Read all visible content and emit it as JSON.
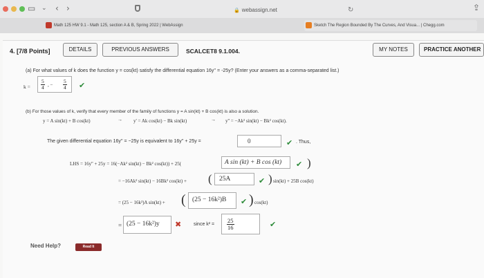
{
  "browser": {
    "url": "webassign.net",
    "tabs": [
      {
        "label": "Math 125 HW 9.1 - Math 125, section A & B, Spring 2022 | WebAssign",
        "color": "#c0392b"
      },
      {
        "label": "Sketch The Region Bounded By The Curves, And Visua... | Chegg.com",
        "color": "#e67e22"
      }
    ]
  },
  "question": {
    "number": "4.",
    "points": "[7/8 Points]",
    "buttons": {
      "details": "DETAILS",
      "previous_answers": "PREVIOUS ANSWERS",
      "my_notes": "MY NOTES",
      "practice": "PRACTICE ANOTHER"
    },
    "source": "SCALCET8 9.1.004.",
    "part_a": {
      "prompt": "(a) For what values of k does the function y = cos(kt) satisfy the differential equation 16y'' = -25y? (Enter your answers as a comma-separated list.)",
      "k_label": "k =",
      "answer_num1": "5",
      "answer_den1": "4",
      "answer_sep": ", −",
      "answer_num2": "5",
      "answer_den2": "4"
    },
    "part_b": {
      "prompt": "(b) For those values of k, verify that every member of the family of functions y = A sin(kt) + B cos(kt) is also a solution.",
      "line1": "y = A sin(kt) + B cos(kt)",
      "arrow": "→",
      "line2": "y' = Ak cos(kt) − Bk sin(kt)",
      "line3": "y'' = −Ak² sin(kt) − Bk² cos(kt).",
      "equiv_text": "The given differential equation 16y'' = −25y is equivalent to 16y'' + 25y =",
      "equiv_answer": "0",
      "thus": ". Thus,",
      "lhs_text": "LHS = 16y'' + 25y = 16(−Ak² sin(kt) − Bk² cos(kt)) + 25(",
      "lhs_answer": "A sin (kt) + B cos (kt)",
      "row2_text": "= −16Ak² sin(kt) − 16Bk² cos(kt) +",
      "row2_answer": "25A",
      "row2_tail": "sin(kt) + 25B cos(kt)",
      "row3_text": "= (25 − 16k²)A sin(kt) +",
      "row3_answer": "(25 − 16k²)B",
      "row3_tail": "cos(kt)",
      "row4_eq": "=",
      "row4_answer": "(25 − 16k²)y",
      "since_text": "since k² =",
      "since_num": "25",
      "since_den": "16"
    },
    "help": {
      "label": "Need Help?",
      "read_it": "Read It"
    }
  }
}
